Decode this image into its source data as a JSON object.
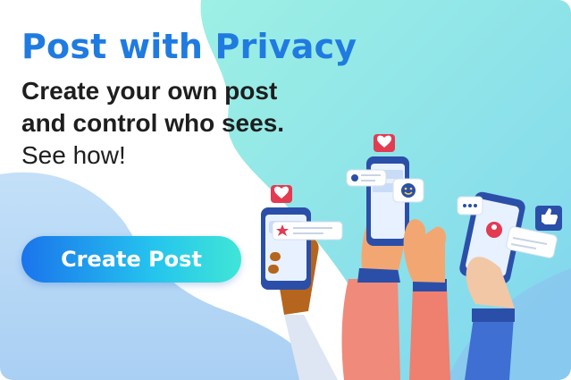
{
  "promo": {
    "title": "Post with Privacy",
    "subtitle_bold": "Create your own post and control who sees.",
    "subtitle_link": "See how!",
    "cta_label": "Create Post"
  },
  "colors": {
    "title": "#1f7be0",
    "text": "#1e1e1e",
    "button_start": "#1a74ec",
    "button_end": "#3fe6d6",
    "bg_teal": "#8ee8e0",
    "bg_blue": "#b6d7f5"
  },
  "illustration": {
    "icons": [
      "heart-icon",
      "star-icon",
      "person-icon",
      "smiley-icon",
      "thumbs-up-icon",
      "ellipsis-icon"
    ]
  }
}
